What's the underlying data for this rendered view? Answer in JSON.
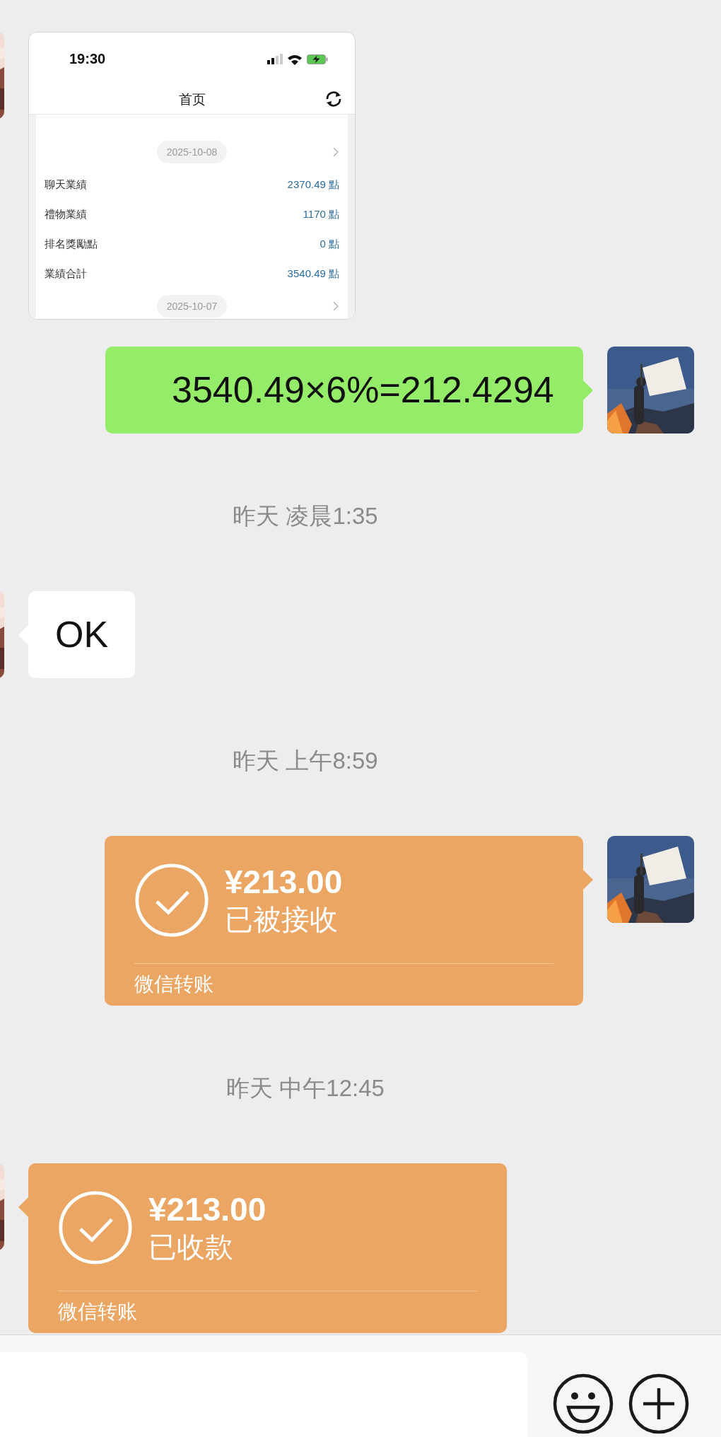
{
  "messages": [
    {
      "kind": "screenshot",
      "outgoing": false,
      "screenshot": {
        "status_time": "19:30",
        "title": "首页",
        "sections": [
          {
            "date": "2025-10-08",
            "rows": [
              {
                "label": "聊天業績",
                "value": "2370.49 點"
              },
              {
                "label": "禮物業績",
                "value": "1170 點"
              },
              {
                "label": "排名獎勵點",
                "value": "0 點"
              },
              {
                "label": "業績合計",
                "value": "3540.49 點"
              }
            ]
          },
          {
            "date": "2025-10-07"
          }
        ]
      }
    },
    {
      "kind": "text",
      "outgoing": true,
      "text": "3540.49×6%=212.4294"
    },
    {
      "kind": "time",
      "text": "昨天 凌晨1:35"
    },
    {
      "kind": "text",
      "outgoing": false,
      "text": "OK"
    },
    {
      "kind": "time",
      "text": "昨天 上午8:59"
    },
    {
      "kind": "transfer",
      "outgoing": true,
      "amount": "¥213.00",
      "status": "已被接收",
      "footer": "微信转账"
    },
    {
      "kind": "time",
      "text": "昨天 中午12:45"
    },
    {
      "kind": "transfer",
      "outgoing": false,
      "amount": "¥213.00",
      "status": "已收款",
      "footer": "微信转账"
    }
  ]
}
